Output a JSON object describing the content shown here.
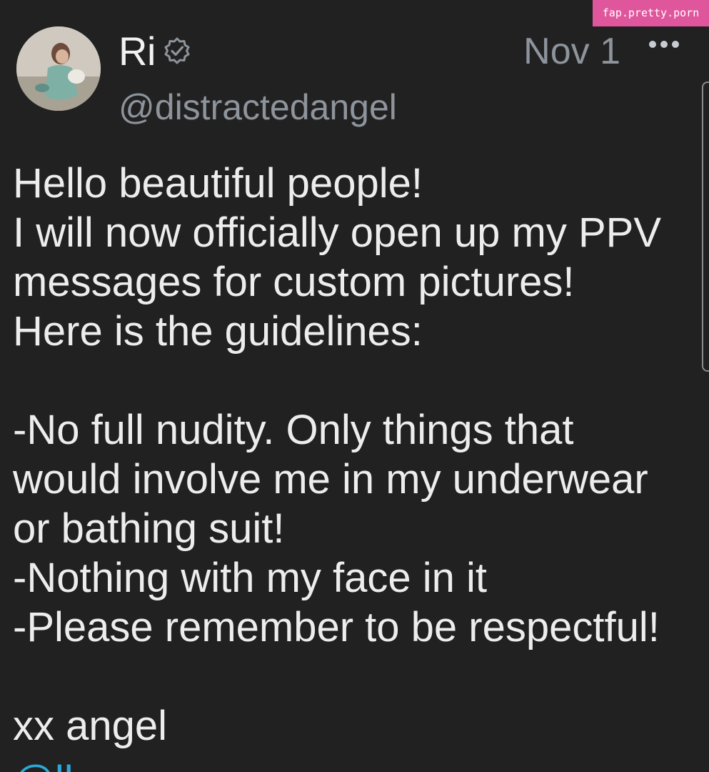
{
  "watermark": {
    "text": "fap.pretty.porn"
  },
  "post": {
    "author_name": "Ri",
    "author_handle": "@distractedangel",
    "date": "Nov 1",
    "verified_icon": "verified-badge-icon",
    "more_icon": "more-dots-icon",
    "lines": [
      "Hello beautiful people!",
      "I will now officially open up my PPV",
      "messages for custom pictures!",
      "Here is the guidelines:",
      "",
      "-No full nudity. Only things that",
      "would involve me in my underwear",
      "or bathing suit!",
      "-Nothing with my face in it",
      "-Please remember to be respectful!",
      "",
      "xx angel"
    ],
    "link_fragment": "@ll"
  },
  "colors": {
    "background": "#212121",
    "text": "#ededed",
    "muted": "#8e949c",
    "link": "#2aa8d8",
    "watermark_bg": "#e0569c"
  }
}
